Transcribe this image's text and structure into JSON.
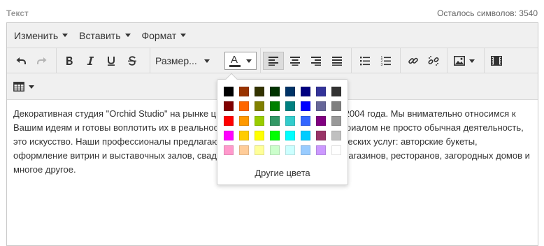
{
  "field": {
    "label": "Текст",
    "counter": "Осталось символов: 3540"
  },
  "menubar": [
    {
      "label": "Изменить"
    },
    {
      "label": "Вставить"
    },
    {
      "label": "Формат"
    }
  ],
  "toolbar": {
    "size_label": "Размер...",
    "font_color_letter": "A",
    "font_color_value": "#333333",
    "active_align": "left"
  },
  "content": {
    "text": "Декоративная студия \"Orchid Studio\" на рынке цветочного бизнеса работает с 2004 года. Мы внимательно относимся к Вашим идеям и готовы воплотить их в реальность. Ведь работа с живым материалом не просто обычная деятельность, это искусство. Наши профессионалы предлагают полный комплекс флористических услуг: авторские букеты, оформление витрин и выставочных залов, свадеб, праздников, оформление магазинов, ресторанов, загородных домов и многое другое."
  },
  "color_picker": {
    "colors": [
      "#000000",
      "#993300",
      "#333300",
      "#003300",
      "#003366",
      "#000080",
      "#333399",
      "#333333",
      "#800000",
      "#FF6600",
      "#808000",
      "#008000",
      "#008080",
      "#0000FF",
      "#666699",
      "#808080",
      "#FF0000",
      "#FF9900",
      "#99CC00",
      "#339966",
      "#33CCCC",
      "#3366FF",
      "#800080",
      "#999999",
      "#FF00FF",
      "#FFCC00",
      "#FFFF00",
      "#00FF00",
      "#00FFFF",
      "#00CCFF",
      "#993366",
      "#C0C0C0",
      "#FF99CC",
      "#FFCC99",
      "#FFFF99",
      "#CCFFCC",
      "#CCFFFF",
      "#99CCFF",
      "#CC99FF",
      "#FFFFFF"
    ],
    "more_label": "Другие цвета"
  }
}
